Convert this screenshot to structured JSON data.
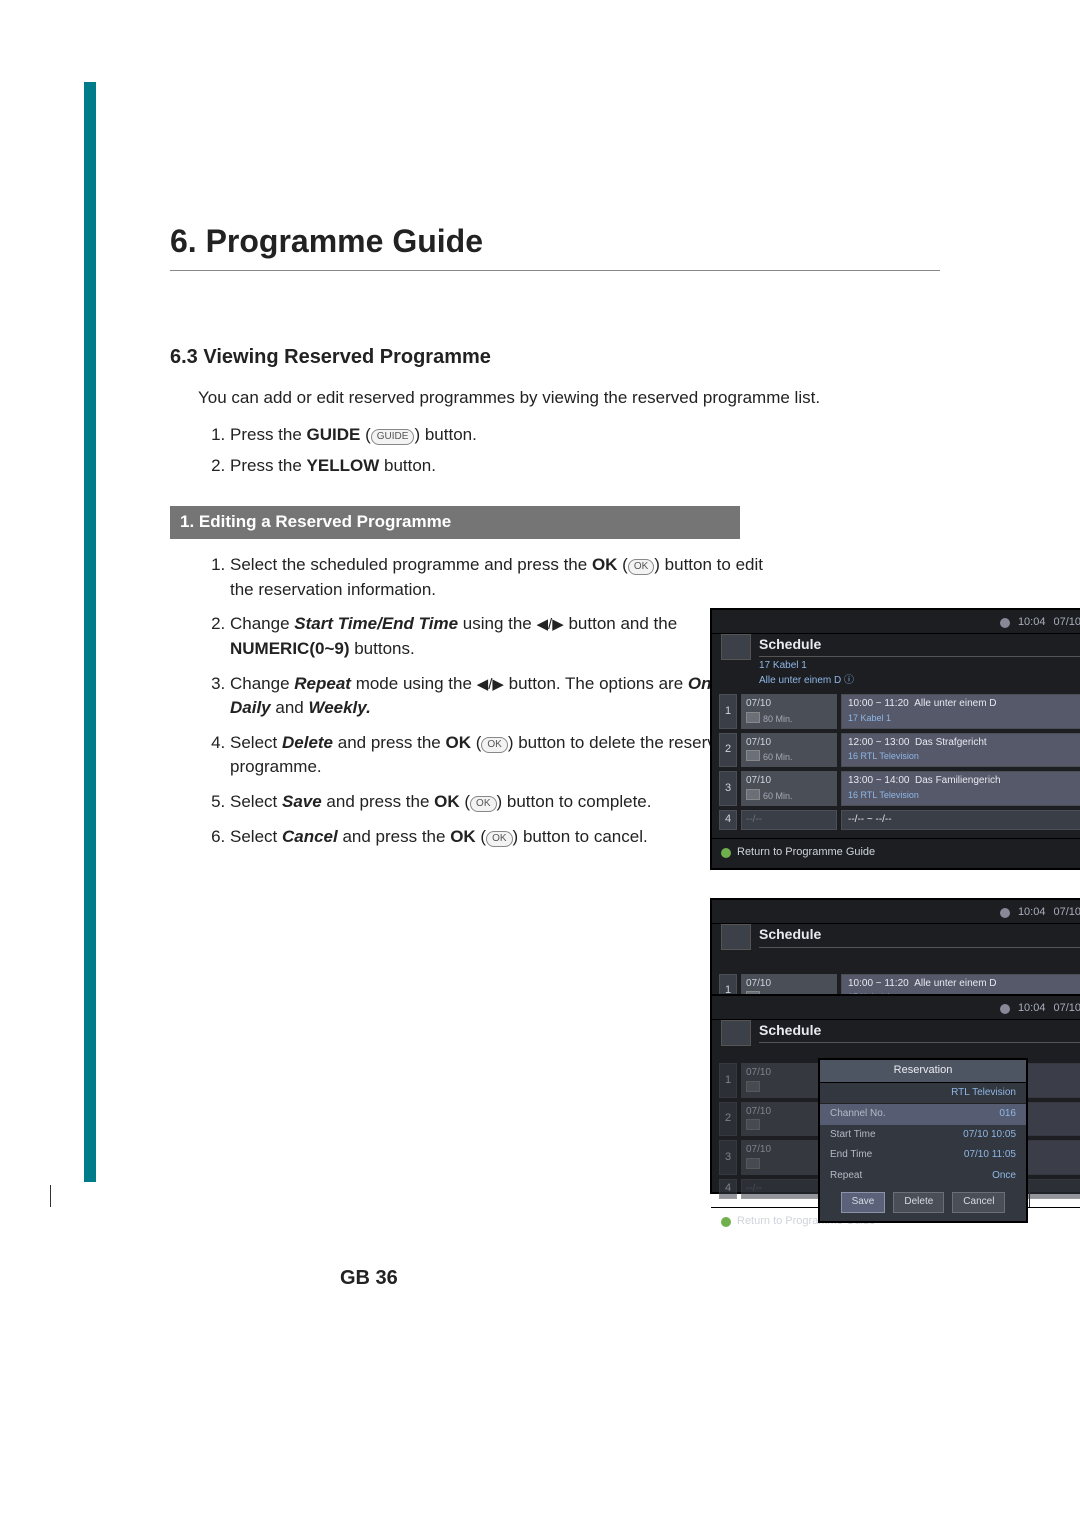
{
  "chapter": {
    "title": "6. Programme Guide"
  },
  "section": {
    "title": "6.3 Viewing Reserved Programme"
  },
  "intro": "You can add or edit reserved programmes by viewing the reserved programme list.",
  "steps": {
    "s1_a": "Press the ",
    "s1_b": "GUIDE",
    "s1_c": " button.",
    "s1_icon": "GUIDE",
    "s2_a": "Press the ",
    "s2_b": "YELLOW",
    "s2_c": " button."
  },
  "subhead": "1. Editing a Reserved Programme",
  "editSteps": {
    "e1_a": "Select the scheduled programme and press the ",
    "e1_b": "OK",
    "e1_c": " button to edit the reservation information.",
    "e1_icon": "OK",
    "e2_a": "Change ",
    "e2_b": "Start Time/End Time",
    "e2_c": " using the ",
    "e2_d": " button and the ",
    "e2_e": "NUMERIC(0~9)",
    "e2_f": " buttons.",
    "e3_a": "Change ",
    "e3_b": "Repeat",
    "e3_c": " mode using the ",
    "e3_d": " button. The options are ",
    "e3_e": "Once, Daily",
    "e3_f": " and ",
    "e3_g": "Weekly.",
    "e4_a": "Select ",
    "e4_b": "Delete",
    "e4_c": " and press the ",
    "e4_d": "OK",
    "e4_e": " button to delete the reserved programme.",
    "e4_icon": "OK",
    "e5_a": "Select ",
    "e5_b": "Save",
    "e5_c": " and press the ",
    "e5_d": "OK",
    "e5_e": " button to complete.",
    "e5_icon": "OK",
    "e6_a": "Select ",
    "e6_b": "Cancel",
    "e6_c": " and press the ",
    "e6_d": "OK",
    "e6_e": " button to cancel.",
    "e6_icon": "OK"
  },
  "arrow_lr": "◀/▶",
  "page_number": "GB 36",
  "tv": {
    "clock_time": "10:04",
    "clock_date": "07/10",
    "schedule_title": "Schedule",
    "header_channel": "17 Kabel 1",
    "header_prog": "Alle unter einem D ⓘ",
    "footer": "Return to Programme Guide",
    "rows": [
      {
        "num": "1",
        "date": "07/10",
        "dur": "80 Min.",
        "time": "10:00 ~ 11:20",
        "prog": "Alle unter einem D",
        "chan": "17  Kabel 1"
      },
      {
        "num": "2",
        "date": "07/10",
        "dur": "60 Min.",
        "time": "12:00 ~ 13:00",
        "prog": "Das Strafgericht",
        "chan": "16  RTL Television"
      },
      {
        "num": "3",
        "date": "07/10",
        "dur": "60 Min.",
        "time": "13:00 ~ 14:00",
        "prog": "Das Familiengerich",
        "chan": "16  RTL Television"
      }
    ],
    "empty": {
      "num": "4",
      "d": "--/--",
      "m": "--/-- ~ --/--"
    },
    "dialog": {
      "title": "Reservation",
      "sub": "RTL Television",
      "channel_no_label": "Channel No.",
      "channel_no_value": "016",
      "start_label": "Start Time",
      "start_value": "07/10  10:05",
      "end_label": "End Time",
      "end_value": "07/10  11:05",
      "repeat_label": "Repeat",
      "repeat_value": "Once",
      "btn_save": "Save",
      "btn_delete": "Delete",
      "btn_cancel": "Cancel"
    }
  }
}
